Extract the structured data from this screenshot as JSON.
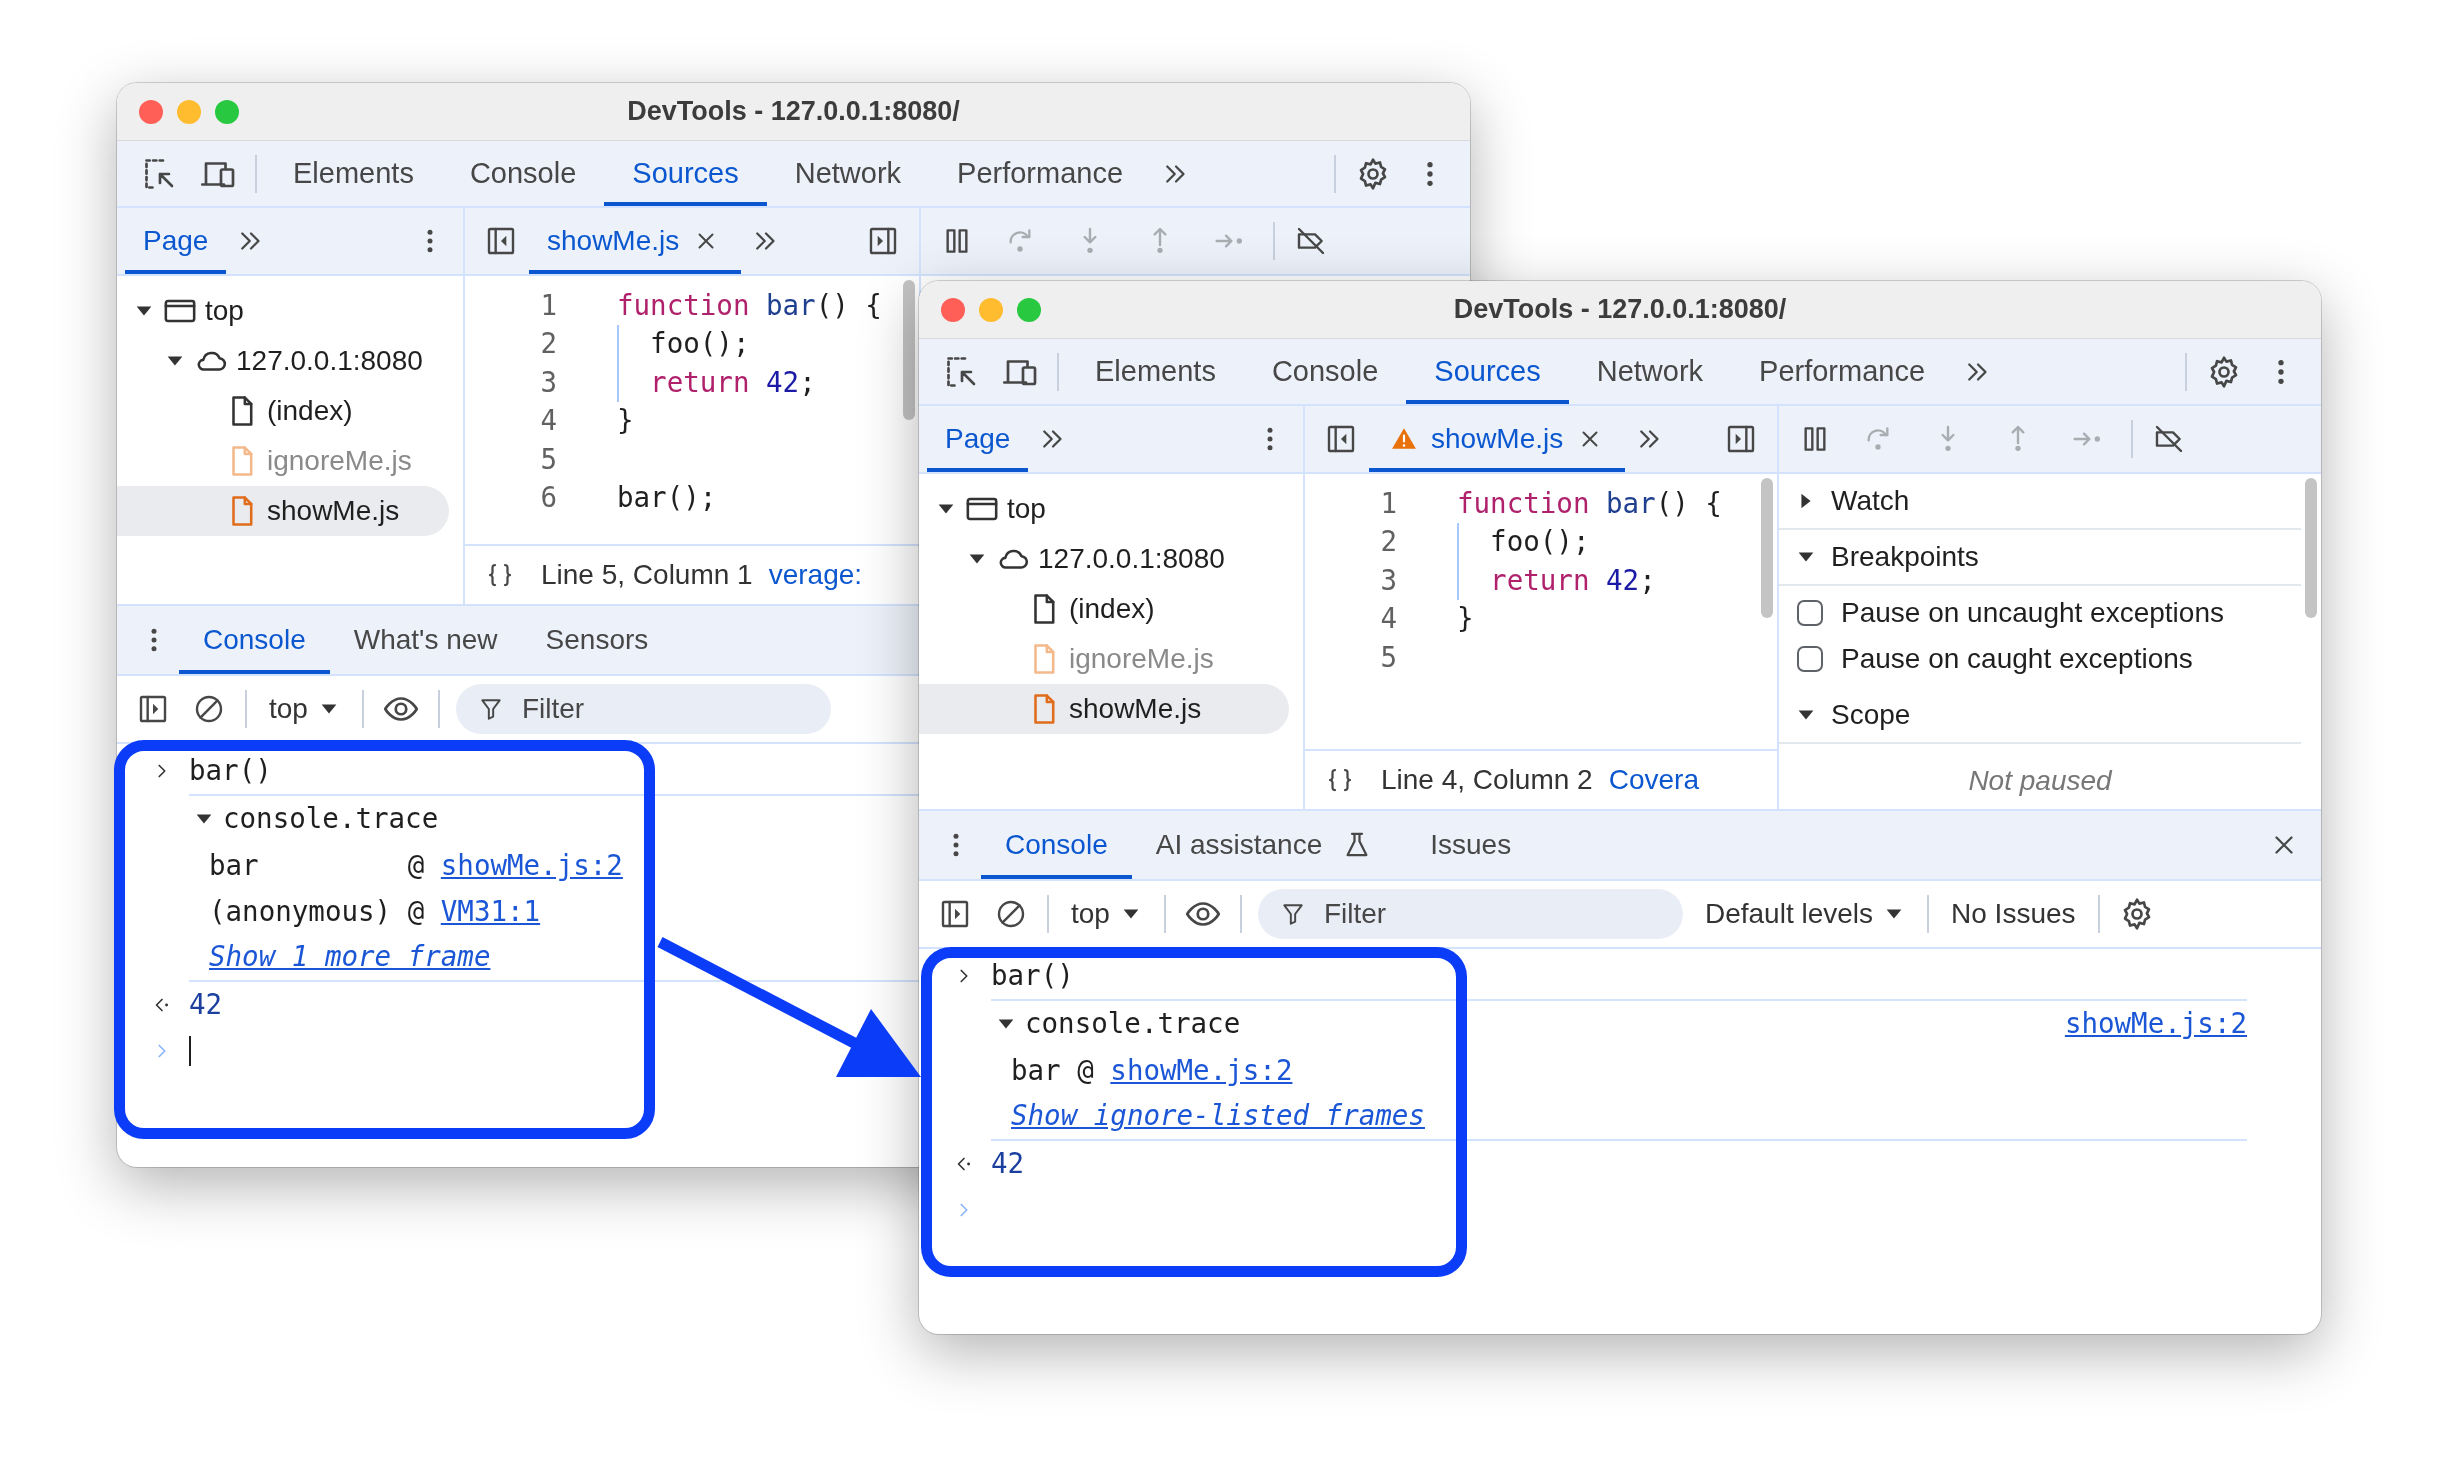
{
  "windows": [
    {
      "title": "DevTools - 127.0.0.1:8080/",
      "main_tabs": [
        {
          "label": "Elements",
          "selected": false
        },
        {
          "label": "Console",
          "selected": false
        },
        {
          "label": "Sources",
          "selected": true
        },
        {
          "label": "Network",
          "selected": false
        },
        {
          "label": "Performance",
          "selected": false
        }
      ],
      "navigator": {
        "tabs": [
          {
            "label": "Page",
            "selected": true
          }
        ],
        "tree": [
          {
            "label": "top",
            "kind": "frame",
            "expanded": true,
            "children": [
              {
                "label": "127.0.0.1:8080",
                "kind": "origin",
                "expanded": true,
                "children": [
                  {
                    "label": "(index)",
                    "kind": "document",
                    "ignored": false,
                    "selected": false
                  },
                  {
                    "label": "ignoreMe.js",
                    "kind": "script",
                    "ignored": true,
                    "selected": false
                  },
                  {
                    "label": "showMe.js",
                    "kind": "script",
                    "ignored": false,
                    "selected": true
                  }
                ]
              }
            ]
          }
        ]
      },
      "editor": {
        "tabs": [
          {
            "label": "showMe.js",
            "warning": false,
            "selected": true
          }
        ],
        "lines": [
          {
            "number": "1",
            "tokens": [
              {
                "kind": "keyword",
                "text": "function"
              },
              {
                "kind": "name",
                "text": " bar"
              },
              {
                "kind": "plain",
                "text": "() {"
              }
            ]
          },
          {
            "number": "2",
            "indented": true,
            "tokens": [
              {
                "kind": "plain",
                "text": "foo();"
              }
            ]
          },
          {
            "number": "3",
            "indented": true,
            "tokens": [
              {
                "kind": "keyword",
                "text": "return"
              },
              {
                "kind": "number",
                "text": " 42"
              },
              {
                "kind": "plain",
                "text": ";"
              }
            ]
          },
          {
            "number": "4",
            "tokens": [
              {
                "kind": "plain",
                "text": "}"
              }
            ]
          },
          {
            "number": "5"
          },
          {
            "number": "6",
            "tokens": [
              {
                "kind": "plain",
                "text": "bar();"
              }
            ]
          }
        ],
        "status": {
          "position": "Line 5, Column 1",
          "coverage": "verage:"
        }
      },
      "debugger": {
        "stepping_enabled": false
      },
      "drawer": {
        "tabs": [
          {
            "label": "Console",
            "selected": true,
            "experimental": false
          },
          {
            "label": "What's new",
            "selected": false,
            "experimental": false
          },
          {
            "label": "Sensors",
            "selected": false,
            "experimental": false
          }
        ],
        "toolbar": {
          "context": "top",
          "filter": {
            "placeholder": "Filter"
          }
        },
        "messages": [
          {
            "kind": "input",
            "text": "bar()"
          },
          {
            "kind": "trace",
            "label": "console.trace",
            "expanded": true,
            "frames": [
              {
                "function": "bar",
                "at": "@",
                "link": "showMe.js:2"
              },
              {
                "function": "(anonymous)",
                "at": "@",
                "link": "VM31:1"
              }
            ],
            "more_link": "Show 1 more frame"
          },
          {
            "kind": "result",
            "text": "42"
          },
          {
            "kind": "prompt",
            "focused": true
          }
        ]
      }
    },
    {
      "title": "DevTools - 127.0.0.1:8080/",
      "main_tabs": [
        {
          "label": "Elements",
          "selected": false
        },
        {
          "label": "Console",
          "selected": false
        },
        {
          "label": "Sources",
          "selected": true
        },
        {
          "label": "Network",
          "selected": false
        },
        {
          "label": "Performance",
          "selected": false
        }
      ],
      "navigator": {
        "tabs": [
          {
            "label": "Page",
            "selected": true
          }
        ],
        "tree": [
          {
            "label": "top",
            "kind": "frame",
            "expanded": true,
            "children": [
              {
                "label": "127.0.0.1:8080",
                "kind": "origin",
                "expanded": true,
                "children": [
                  {
                    "label": "(index)",
                    "kind": "document",
                    "ignored": false,
                    "selected": false
                  },
                  {
                    "label": "ignoreMe.js",
                    "kind": "script",
                    "ignored": true,
                    "selected": false
                  },
                  {
                    "label": "showMe.js",
                    "kind": "script",
                    "ignored": false,
                    "selected": true
                  }
                ]
              }
            ]
          }
        ]
      },
      "editor": {
        "tabs": [
          {
            "label": "showMe.js",
            "warning": true,
            "selected": true
          }
        ],
        "lines": [
          {
            "number": "1",
            "tokens": [
              {
                "kind": "keyword",
                "text": "function"
              },
              {
                "kind": "name",
                "text": " bar"
              },
              {
                "kind": "plain",
                "text": "() {"
              }
            ]
          },
          {
            "number": "2",
            "indented": true,
            "tokens": [
              {
                "kind": "plain",
                "text": "foo();"
              }
            ]
          },
          {
            "number": "3",
            "indented": true,
            "tokens": [
              {
                "kind": "keyword",
                "text": "return"
              },
              {
                "kind": "number",
                "text": " 42"
              },
              {
                "kind": "plain",
                "text": ";"
              }
            ]
          },
          {
            "number": "4",
            "tokens": [
              {
                "kind": "plain",
                "text": "}"
              }
            ]
          },
          {
            "number": "5"
          }
        ],
        "status": {
          "position": "Line 4, Column 2",
          "coverage": "Covera"
        }
      },
      "debugger": {
        "stepping_enabled": false,
        "sections": [
          {
            "title": "Watch",
            "expanded": false
          },
          {
            "title": "Breakpoints",
            "expanded": true,
            "checkboxes": [
              {
                "label": "Pause on uncaught exceptions",
                "checked": false
              },
              {
                "label": "Pause on caught exceptions",
                "checked": false
              }
            ]
          },
          {
            "title": "Scope",
            "expanded": true,
            "empty_text": "Not paused"
          }
        ]
      },
      "drawer": {
        "tabs": [
          {
            "label": "Console",
            "selected": true,
            "experimental": false
          },
          {
            "label": "AI assistance",
            "selected": false,
            "experimental": true
          },
          {
            "label": "Issues",
            "selected": false,
            "experimental": false
          }
        ],
        "closable": true,
        "toolbar": {
          "context": "top",
          "filter": {
            "placeholder": "Filter"
          },
          "levels": "Default levels",
          "issues": "No Issues"
        },
        "messages": [
          {
            "kind": "input",
            "text": "bar()"
          },
          {
            "kind": "trace",
            "label": "console.trace",
            "expanded": true,
            "source": "showMe.js:2",
            "frames": [
              {
                "function": "bar",
                "at": "@",
                "link": "showMe.js:2"
              }
            ],
            "more_link": "Show ignore-listed frames"
          },
          {
            "kind": "result",
            "text": "42"
          },
          {
            "kind": "prompt",
            "focused": false
          }
        ]
      }
    }
  ]
}
